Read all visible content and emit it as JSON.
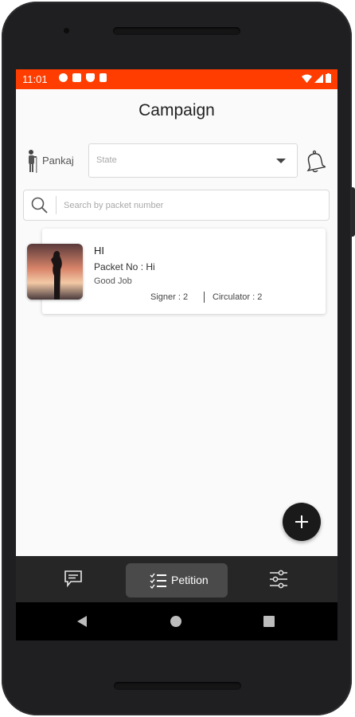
{
  "status_bar": {
    "time": "11:01"
  },
  "header": {
    "title": "Campaign"
  },
  "filter": {
    "user_name": "Pankaj",
    "state_placeholder": "State"
  },
  "search": {
    "placeholder": "Search by packet number"
  },
  "petitions": [
    {
      "title": "HI",
      "packet_label": "Packet No :",
      "packet_value": "Hi",
      "description": "Good Job",
      "signer_text": "Signer : 2",
      "circulator_text": "Circulator : 2"
    }
  ],
  "bottom_nav": {
    "items": [
      {
        "icon": "chat-icon",
        "label": ""
      },
      {
        "icon": "checklist-icon",
        "label": "Petition",
        "active": true
      },
      {
        "icon": "sliders-icon",
        "label": ""
      }
    ]
  },
  "colors": {
    "status_bar": "#ff3d00",
    "nav_bg": "#262626",
    "fab": "#1a1a1a"
  },
  "icons": [
    "settings-icon",
    "image-icon",
    "shield-icon",
    "sd-card-icon",
    "wifi-icon",
    "signal-icon",
    "battery-icon",
    "person-icon",
    "bell-icon",
    "search-icon",
    "plus-icon",
    "back-icon",
    "home-icon",
    "recents-icon"
  ]
}
